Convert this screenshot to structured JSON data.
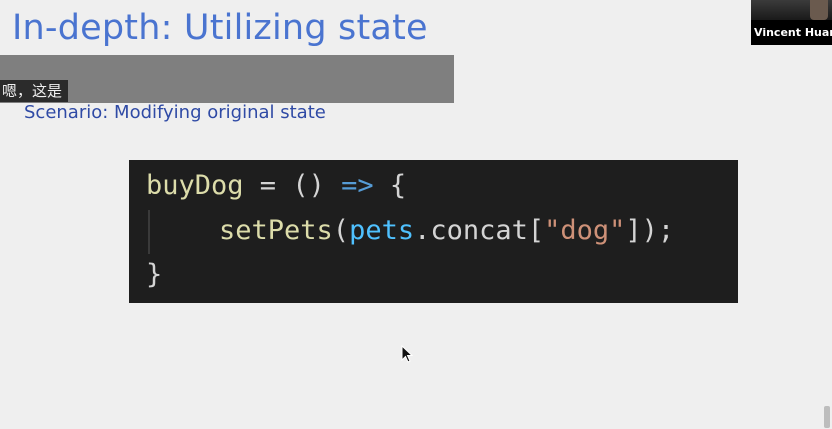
{
  "slide": {
    "title": "In-depth: Utilizing state",
    "scenario": "Scenario: Modifying original state"
  },
  "caption": {
    "text": "嗯，这是"
  },
  "code": {
    "line1": {
      "name": "buyDog",
      "assign": " = () ",
      "arrow": "=>",
      "open": " {"
    },
    "line2": {
      "fn": "setPets",
      "paren_open": "(",
      "var": "pets",
      "method": ".concat[",
      "string": "\"dog\"",
      "close": "]);"
    },
    "line3": {
      "close": "}"
    }
  },
  "video": {
    "participant_name": "Vincent Huang"
  },
  "colors": {
    "title": "#4a74d0",
    "scenario": "#2f4aa5",
    "code_bg": "#1e1e1e",
    "code_fn": "#dcdcaa",
    "code_var": "#4fc1ff",
    "code_string": "#ce9178"
  },
  "icons": {
    "cursor": "mouse-pointer-icon"
  }
}
